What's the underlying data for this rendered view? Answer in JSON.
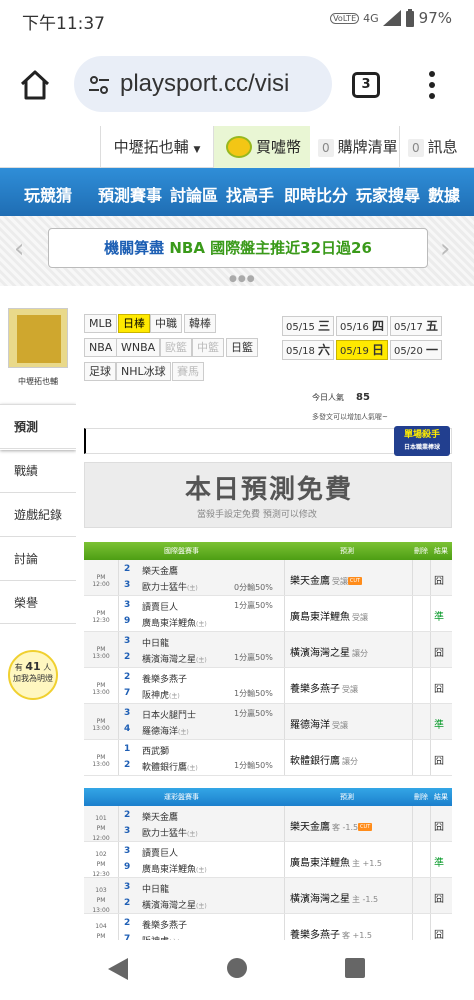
{
  "status": {
    "time": "下午11:37",
    "battery": "97%",
    "network": "4G",
    "volte": "VoLTE"
  },
  "browser": {
    "url": "playsport.cc/visi",
    "tab_count": "3"
  },
  "topnav": {
    "user": "中壢拓也輔",
    "coin": "買噓幣",
    "cart_count": "0",
    "cart": "購牌清單",
    "msg_count": "0",
    "msg": "訊息"
  },
  "mainnav": [
    "玩競猜",
    "預測賽事",
    "討論區",
    "找高手",
    "即時比分",
    "玩家搜尋",
    "數據"
  ],
  "banner": {
    "text_a": "機關算盡 ",
    "text_b": "NBA 國際盤主推近32日過26"
  },
  "sidebar": {
    "username": "中壢拓也輔",
    "menu": [
      "預測",
      "戰績",
      "遊戲紀錄",
      "討論",
      "榮譽"
    ],
    "fans_pre": "有",
    "fans_count": "41",
    "fans_unit": "人",
    "fans_post": "加我為明燈"
  },
  "leagues": {
    "row1": [
      "MLB",
      "日棒",
      "中職",
      "韓棒"
    ],
    "row2": [
      "NBA",
      "WNBA",
      "歐籃",
      "中籃",
      "日籃"
    ],
    "row3": [
      "足球",
      "NHL冰球",
      "賽馬"
    ],
    "selected": "日棒"
  },
  "dates": [
    {
      "md": "05/15",
      "wd": "三"
    },
    {
      "md": "05/16",
      "wd": "四"
    },
    {
      "md": "05/17",
      "wd": "五"
    },
    {
      "md": "05/18",
      "wd": "六"
    },
    {
      "md": "05/19",
      "wd": "日"
    },
    {
      "md": "05/20",
      "wd": "一"
    }
  ],
  "today": {
    "label": "今日人氣",
    "value": "85",
    "hint": "多發文可以增加人氣喔~"
  },
  "killer": {
    "line1": "單場殺手",
    "line2": "日本職業棒球"
  },
  "free": {
    "title": "本日預測免費",
    "sub": "當殺手設定免費 預測可以修改"
  },
  "intl_table": {
    "headers": {
      "match": "國際盤賽事",
      "pick": "預測",
      "del": "刪除",
      "result": "結果"
    },
    "rows": [
      {
        "time": "PM 12:00",
        "n1": "2",
        "t1": "樂天金鷹",
        "n2": "3",
        "t2": "歐力士猛牛",
        "h": "(主)",
        "odds": "0分輸50%",
        "pick": "樂天金鷹",
        "mark": "受讓",
        "ic": "CUT",
        "res": "囧"
      },
      {
        "time": "PM 12:30",
        "n1": "3",
        "t1": "讀賣巨人",
        "n2": "9",
        "t2": "廣島東洋鯉魚",
        "h": "(主)",
        "odds": "1分贏50%",
        "pick": "廣島東洋鯉魚",
        "mark": "受讓",
        "ic": "",
        "res": "準"
      },
      {
        "time": "PM 13:00",
        "n1": "3",
        "t1": "中日龍",
        "n2": "2",
        "t2": "橫濱海灣之星",
        "h": "(主)",
        "odds": "1分贏50%",
        "pick": "橫濱海灣之星",
        "mark": "讓分",
        "ic": "",
        "res": "囧"
      },
      {
        "time": "PM 13:00",
        "n1": "2",
        "t1": "養樂多燕子",
        "n2": "7",
        "t2": "阪神虎",
        "h": "(主)",
        "odds": "1分輸50%",
        "pick": "養樂多燕子",
        "mark": "受讓",
        "ic": "",
        "res": "囧"
      },
      {
        "time": "PM 13:00",
        "n1": "3",
        "t1": "日本火腿鬥士",
        "n2": "4",
        "t2": "羅德海洋",
        "h": "(主)",
        "odds": "1分贏50%",
        "pick": "羅德海洋",
        "mark": "受讓",
        "ic": "",
        "res": "準"
      },
      {
        "time": "PM 13:00",
        "n1": "1",
        "t1": "西武獅",
        "n2": "2",
        "t2": "軟體銀行鷹",
        "h": "(主)",
        "odds": "1分輸50%",
        "pick": "軟體銀行鷹",
        "mark": "讓分",
        "ic": "",
        "res": "囧"
      }
    ]
  },
  "tw_table": {
    "headers": {
      "match": "運彩盤賽事",
      "pick": "預測",
      "del": "刪除",
      "result": "結果"
    },
    "rows": [
      {
        "id": "101",
        "time": "PM 12:00",
        "n1": "2",
        "t1": "樂天金鷹",
        "n2": "3",
        "t2": "歐力士猛牛",
        "h": "(主)",
        "pick": "樂天金鷹",
        "mark": "客 -1.5",
        "ic": "CUT",
        "res": "囧"
      },
      {
        "id": "102",
        "time": "PM 12:30",
        "n1": "3",
        "t1": "讀賣巨人",
        "n2": "9",
        "t2": "廣島東洋鯉魚",
        "h": "(主)",
        "pick": "廣島東洋鯉魚",
        "mark": "主 +1.5",
        "ic": "",
        "res": "準"
      },
      {
        "id": "103",
        "time": "PM 13:00",
        "n1": "3",
        "t1": "中日龍",
        "n2": "2",
        "t2": "橫濱海灣之星",
        "h": "(主)",
        "pick": "橫濱海灣之星",
        "mark": "主 -1.5",
        "ic": "",
        "res": "囧"
      },
      {
        "id": "104",
        "time": "PM 13:00",
        "n1": "2",
        "t1": "養樂多燕子",
        "n2": "7",
        "t2": "阪神虎",
        "h": "(主)",
        "pick": "養樂多燕子",
        "mark": "客 +1.5",
        "ic": "",
        "res": "囧"
      }
    ]
  }
}
